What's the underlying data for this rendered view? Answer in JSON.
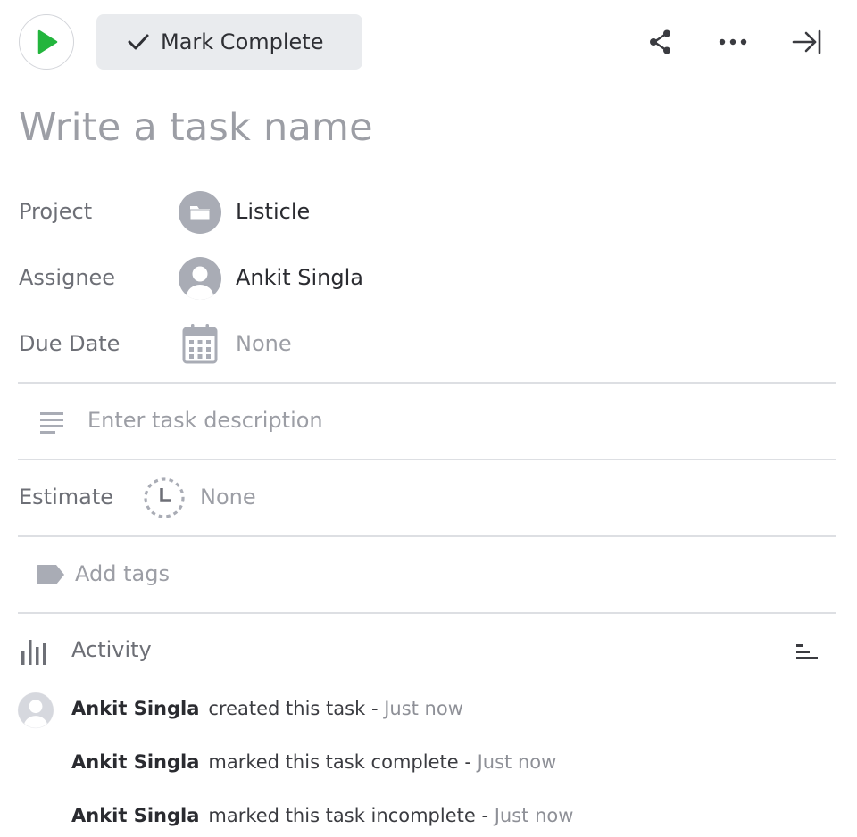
{
  "toolbar": {
    "mark_complete_label": "Mark Complete",
    "play_color": "#23b53d"
  },
  "task": {
    "name_placeholder": "Write a task name"
  },
  "fields": {
    "project": {
      "label": "Project",
      "value": "Listicle",
      "icon": "folder-icon"
    },
    "assignee": {
      "label": "Assignee",
      "value": "Ankit Singla",
      "icon": "avatar-icon"
    },
    "due_date": {
      "label": "Due Date",
      "value": "None",
      "icon": "calendar-icon"
    }
  },
  "description": {
    "placeholder": "Enter task description"
  },
  "estimate": {
    "label": "Estimate",
    "value": "None"
  },
  "tags": {
    "placeholder": "Add tags"
  },
  "activity": {
    "title": "Activity",
    "entries": [
      {
        "user": "Ankit Singla",
        "action": "created this task",
        "sep": " - ",
        "time": "Just now"
      },
      {
        "user": "Ankit Singla",
        "action": "marked this task complete",
        "sep": " - ",
        "time": "Just now"
      },
      {
        "user": "Ankit Singla",
        "action": "marked this task incomplete",
        "sep": " - ",
        "time": "Just now"
      }
    ]
  },
  "colors": {
    "icon_gray": "#a9acb5",
    "text_muted": "#9c9ea5",
    "divider": "#dddfe3"
  }
}
